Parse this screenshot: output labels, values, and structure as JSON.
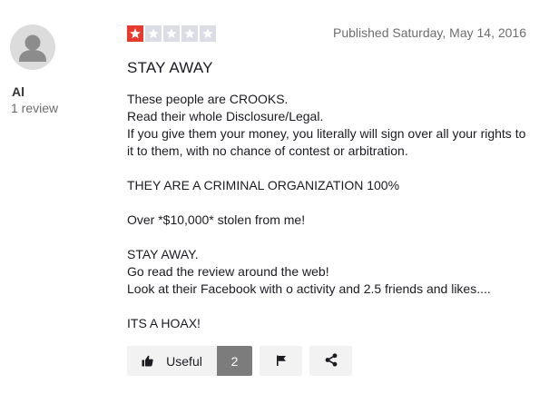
{
  "author": {
    "name": "Al",
    "review_count": "1 review",
    "avatar_icon": "user-avatar-icon"
  },
  "review": {
    "rating": 1,
    "max_rating": 5,
    "rating_color": "#e8392e",
    "empty_star_color": "#dcdce6",
    "published": "Published Saturday, May 14, 2016",
    "title": "STAY AWAY",
    "body": {
      "p1_line1": "These people are CROOKS.",
      "p1_line2": "Read their whole Disclosure/Legal.",
      "p1_line3": "If you give them your money, you literally will sign over all your rights to it to them, with no chance of contest or arbitration.",
      "p2": "THEY ARE A CRIMINAL ORGANIZATION 100%",
      "p3": "Over *$10,000* stolen from me!",
      "p4_line1": "STAY AWAY.",
      "p4_line2": "Go read the review around the web!",
      "p4_line3": "Look at their Facebook with o activity and 2.5 friends and likes....",
      "p5": "ITS A HOAX!"
    }
  },
  "actions": {
    "useful_label": "Useful",
    "useful_count": "2",
    "useful_icon": "thumbs-up-icon",
    "flag_icon": "flag-icon",
    "share_icon": "share-icon"
  }
}
